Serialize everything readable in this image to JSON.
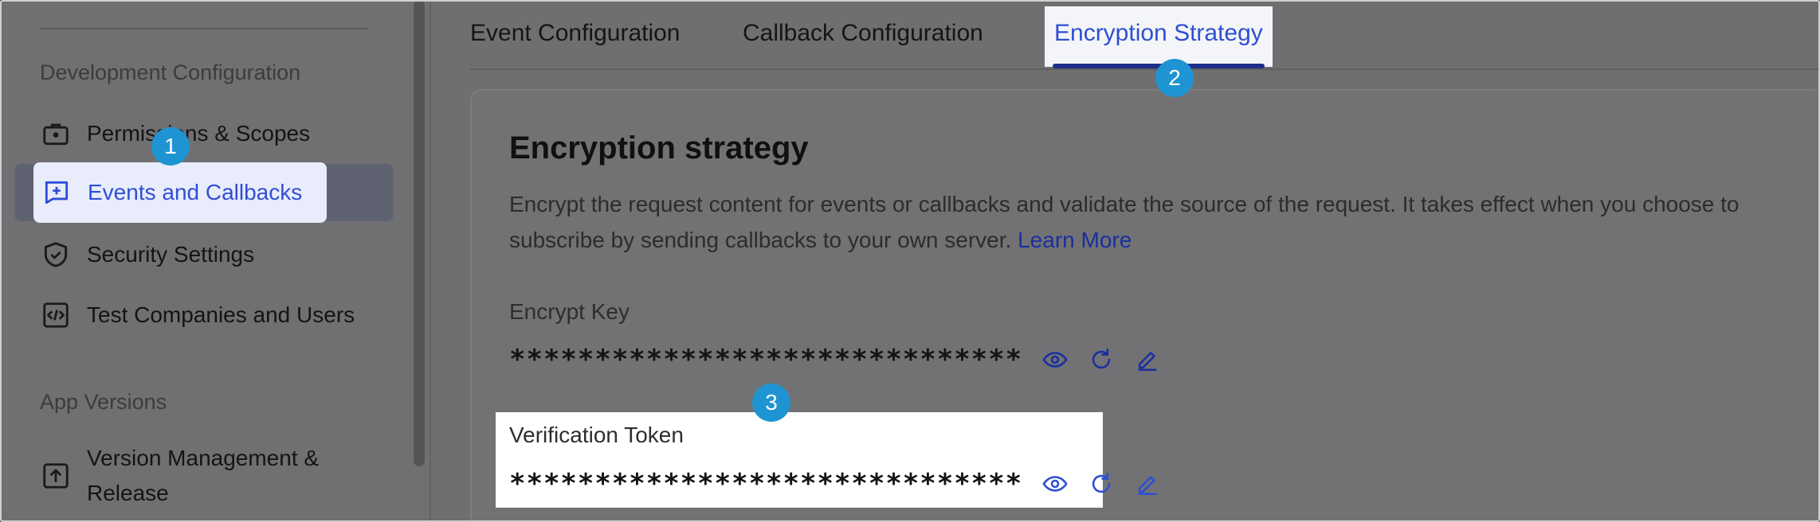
{
  "sidebar": {
    "section_dev": "Development Configuration",
    "section_versions": "App Versions",
    "items": [
      {
        "label": "Permissions & Scopes",
        "icon": "briefcase-icon"
      },
      {
        "label": "Events and Callbacks",
        "icon": "event-plus-icon"
      },
      {
        "label": "Security Settings",
        "icon": "shield-check-icon"
      },
      {
        "label": "Test Companies and Users",
        "icon": "code-box-icon"
      },
      {
        "label_line1": "Version Management &",
        "label_line2": "Release",
        "icon": "upload-box-icon"
      }
    ]
  },
  "tabs": [
    {
      "label": "Event Configuration"
    },
    {
      "label": "Callback Configuration"
    },
    {
      "label": "Encryption Strategy",
      "active": true
    }
  ],
  "card": {
    "title": "Encryption strategy",
    "description": "Encrypt the request content for events or callbacks and validate the source of the request. It takes effect when you choose to subscribe by sending callbacks to your own server.",
    "link": "Learn More",
    "encrypt_key_label": "Encrypt Key",
    "encrypt_key_value": "******************************",
    "verification_token_label": "Verification Token",
    "verification_token_value": "******************************"
  },
  "badges": [
    "1",
    "2",
    "3"
  ],
  "colors": {
    "accent": "#2e4fd3",
    "badge": "#1f94d2",
    "overlay": "#707072"
  }
}
